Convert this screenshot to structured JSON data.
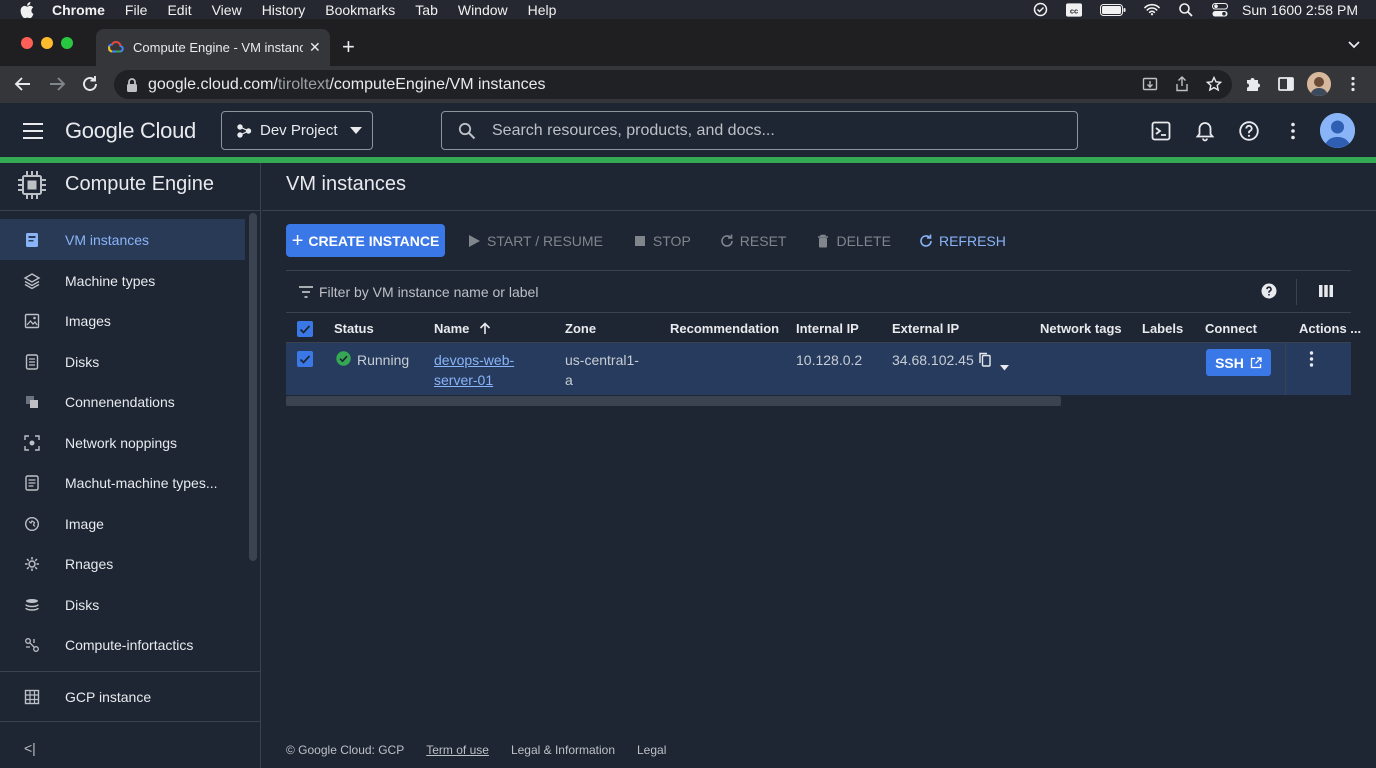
{
  "menubar": {
    "app": "Chrome",
    "items": [
      "File",
      "Edit",
      "View",
      "History",
      "Bookmarks",
      "Tab",
      "Window",
      "Help"
    ],
    "clock": "Sun 1600  2:58 PM"
  },
  "browser": {
    "tab_title": "Compute Engine - VM instances",
    "url_host": "google.cloud.com/",
    "url_dim": "tiroltext",
    "url_path": "/computeEngine/VM instances"
  },
  "header": {
    "logo": "Google Cloud",
    "project": "Dev Project",
    "search_placeholder": "Search resources, products, and docs..."
  },
  "sidebar": {
    "title": "Compute Engine",
    "items": [
      {
        "label": "VM instances",
        "icon": "vm-instance-icon"
      },
      {
        "label": "Machine types",
        "icon": "layers-icon"
      },
      {
        "label": "Images",
        "icon": "image-icon"
      },
      {
        "label": "Disks",
        "icon": "disk-icon"
      },
      {
        "label": "Connenendations",
        "icon": "recommendation-icon"
      },
      {
        "label": "Network noppings",
        "icon": "network-icon"
      },
      {
        "label": "Machut-machine types...",
        "icon": "list-icon"
      },
      {
        "label": "Image",
        "icon": "globe-icon"
      },
      {
        "label": "Rnages",
        "icon": "gear-icon"
      },
      {
        "label": "Disks",
        "icon": "stack-icon"
      },
      {
        "label": "Compute-infortactics",
        "icon": "hub-icon"
      }
    ],
    "bottom_item": "GCP instance",
    "collapse": "<|"
  },
  "main": {
    "title": "VM instances",
    "toolbar": {
      "create": "CREATE INSTANCE",
      "start": "START / RESUME",
      "stop": "STOP",
      "reset": "RESET",
      "delete": "DELETE",
      "refresh": "REFRESH"
    },
    "filter_placeholder": "Filter by VM instance name or label",
    "columns": [
      "Status",
      "Name",
      "Zone",
      "Recommendation",
      "Internal IP",
      "External IP",
      "Network tags",
      "Labels",
      "Connect",
      "Actions ..."
    ],
    "rows": [
      {
        "status": "Running",
        "name_line1": "devops-web-",
        "name_line2": "server-01",
        "zone_line1": "us-central1-",
        "zone_line2": "a",
        "recommendation": "",
        "internal_ip": "10.128.0.2",
        "external_ip": "34.68.102.45",
        "connect": "SSH"
      }
    ]
  },
  "footer": {
    "copyright": "© Google Cloud: GCP",
    "terms": "Term of use",
    "legal_info": "Legal & Information",
    "legal": "Legal"
  },
  "colors": {
    "accent": "#3b78e7",
    "link": "#8ab4f8",
    "status_green": "#34a853",
    "background": "#1e2533"
  }
}
